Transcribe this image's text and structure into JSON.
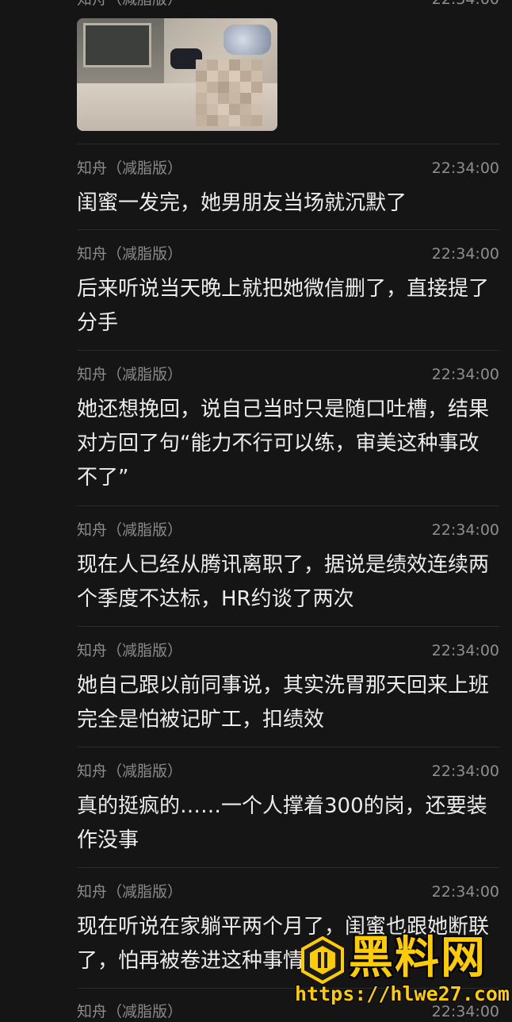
{
  "messages": [
    {
      "sender": "知舟（减脂版）",
      "time": "22:34:00",
      "text": ""
    },
    {
      "sender": "知舟（减脂版）",
      "time": "22:34:00",
      "text": "闺蜜一发完，她男朋友当场就沉默了"
    },
    {
      "sender": "知舟（减脂版）",
      "time": "22:34:00",
      "text": "后来听说当天晚上就把她微信删了，直接提了分手"
    },
    {
      "sender": "知舟（减脂版）",
      "time": "22:34:00",
      "text": "她还想挽回，说自己当时只是随口吐槽，结果对方回了句“能力不行可以练，审美这种事改不了”"
    },
    {
      "sender": "知舟（减脂版）",
      "time": "22:34:00",
      "text": "现在人已经从腾讯离职了，据说是绩效连续两个季度不达标，HR约谈了两次"
    },
    {
      "sender": "知舟（减脂版）",
      "time": "22:34:00",
      "text": "她自己跟以前同事说，其实洗胃那天回来上班完全是怕被记旷工，扣绩效"
    },
    {
      "sender": "知舟（减脂版）",
      "time": "22:34:00",
      "text": "真的挺疯的……一个人撑着300的岗，还要装作没事"
    },
    {
      "sender": "知舟（减脂版）",
      "time": "22:34:00",
      "text": "现在听说在家躺平两个月了，闺蜜也跟她断联了，怕再被卷进这种事情"
    },
    {
      "sender": "知舟（减脂版）",
      "time": "22:34:00",
      "text": ""
    }
  ],
  "watermark": {
    "title": "黑料网",
    "url": "https://hlwe27.com"
  }
}
